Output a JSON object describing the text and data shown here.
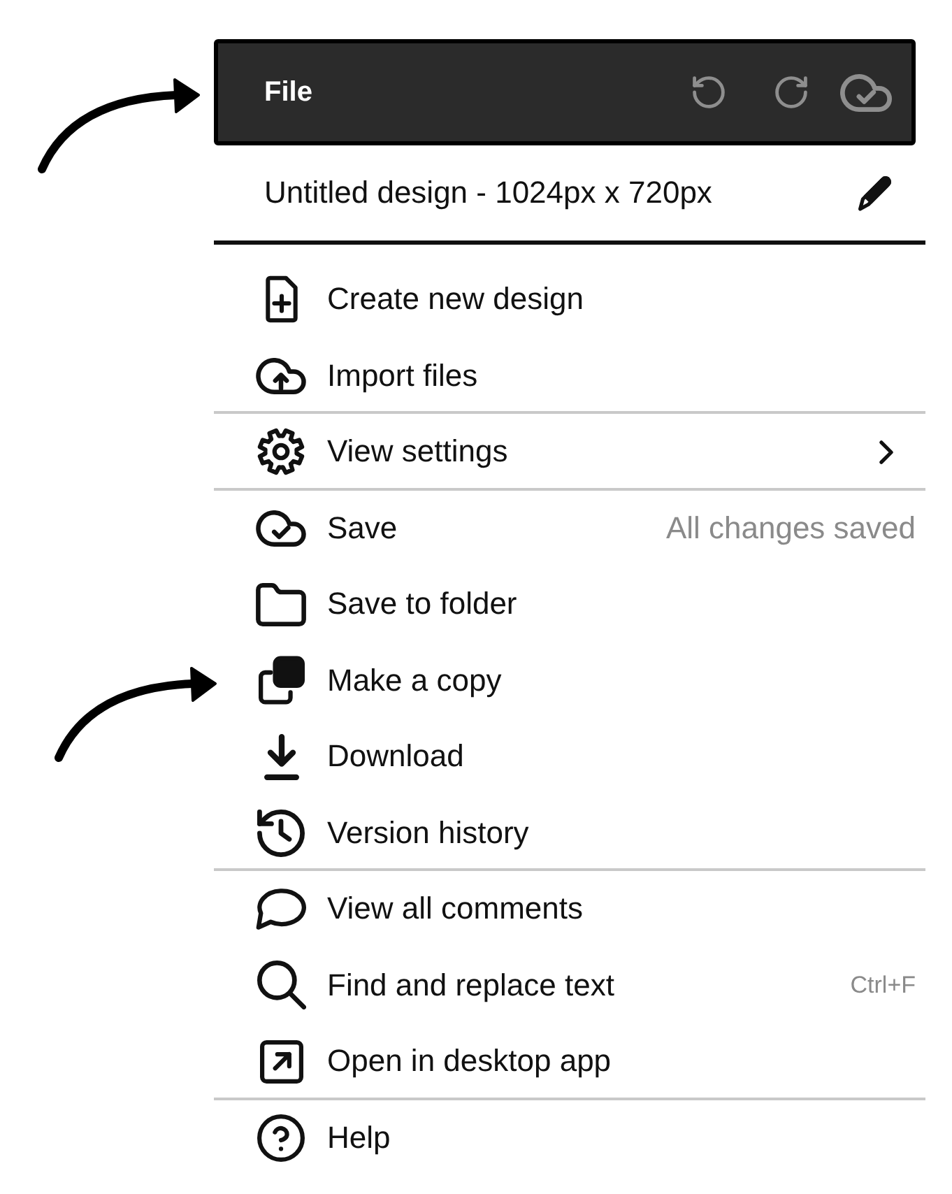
{
  "header": {
    "title": "File"
  },
  "document": {
    "title": "Untitled design - 1024px x 720px"
  },
  "menu": {
    "groups": [
      {
        "items": [
          {
            "label": "Create new design",
            "kind": "action"
          },
          {
            "label": "Import files",
            "kind": "action"
          }
        ]
      },
      {
        "items": [
          {
            "label": "View settings",
            "kind": "submenu"
          }
        ]
      },
      {
        "items": [
          {
            "label": "Save",
            "kind": "action",
            "status": "All changes saved"
          },
          {
            "label": "Save to folder",
            "kind": "action"
          },
          {
            "label": "Make a copy",
            "kind": "action"
          },
          {
            "label": "Download",
            "kind": "action"
          },
          {
            "label": "Version history",
            "kind": "action"
          }
        ]
      },
      {
        "items": [
          {
            "label": "View all comments",
            "kind": "action"
          },
          {
            "label": "Find and replace text",
            "kind": "action",
            "shortcut": "Ctrl+F"
          },
          {
            "label": "Open in desktop app",
            "kind": "action"
          }
        ]
      },
      {
        "items": [
          {
            "label": "Help",
            "kind": "action"
          }
        ]
      }
    ]
  }
}
